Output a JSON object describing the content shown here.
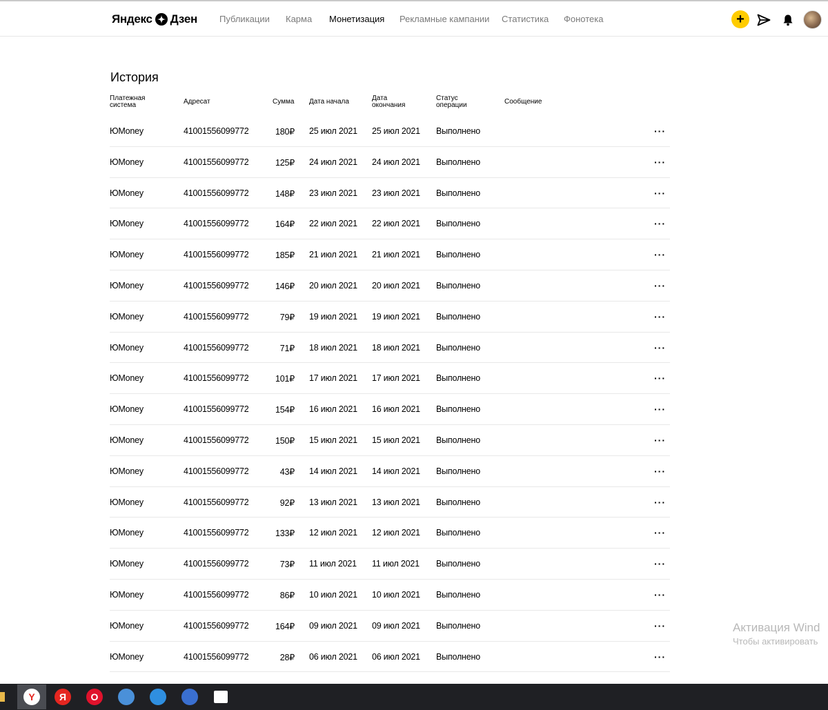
{
  "header": {
    "logo_left": "Яндекс",
    "logo_right": "Дзен",
    "nav": [
      {
        "label": "Публикации",
        "active": false
      },
      {
        "label": "Карма",
        "active": false
      },
      {
        "label": "Монетизация",
        "active": true
      },
      {
        "label": "Рекламные кампании",
        "active": false
      },
      {
        "label": "Статистика",
        "active": false
      },
      {
        "label": "Фонотека",
        "active": false
      }
    ],
    "plus_label": "+",
    "accent": "#ffcc00"
  },
  "page": {
    "title": "История"
  },
  "table": {
    "headers": {
      "system_1": "Платежная",
      "system_2": "система",
      "addressee": "Адресат",
      "sum": "Сумма",
      "start_1": "Дата начала",
      "end_1": "Дата",
      "end_2": "окончания",
      "status_1": "Статус",
      "status_2": "операции",
      "message": "Сообщение"
    },
    "more_label": "···",
    "rows": [
      {
        "system": "ЮMoney",
        "addressee": "41001556099772",
        "sum": "180₽",
        "start": "25 июл 2021",
        "end": "25 июл 2021",
        "status": "Выполнено"
      },
      {
        "system": "ЮMoney",
        "addressee": "41001556099772",
        "sum": "125₽",
        "start": "24 июл 2021",
        "end": "24 июл 2021",
        "status": "Выполнено"
      },
      {
        "system": "ЮMoney",
        "addressee": "41001556099772",
        "sum": "148₽",
        "start": "23 июл 2021",
        "end": "23 июл 2021",
        "status": "Выполнено"
      },
      {
        "system": "ЮMoney",
        "addressee": "41001556099772",
        "sum": "164₽",
        "start": "22 июл 2021",
        "end": "22 июл 2021",
        "status": "Выполнено"
      },
      {
        "system": "ЮMoney",
        "addressee": "41001556099772",
        "sum": "185₽",
        "start": "21 июл 2021",
        "end": "21 июл 2021",
        "status": "Выполнено"
      },
      {
        "system": "ЮMoney",
        "addressee": "41001556099772",
        "sum": "146₽",
        "start": "20 июл 2021",
        "end": "20 июл 2021",
        "status": "Выполнено"
      },
      {
        "system": "ЮMoney",
        "addressee": "41001556099772",
        "sum": "79₽",
        "start": "19 июл 2021",
        "end": "19 июл 2021",
        "status": "Выполнено"
      },
      {
        "system": "ЮMoney",
        "addressee": "41001556099772",
        "sum": "71₽",
        "start": "18 июл 2021",
        "end": "18 июл 2021",
        "status": "Выполнено"
      },
      {
        "system": "ЮMoney",
        "addressee": "41001556099772",
        "sum": "101₽",
        "start": "17 июл 2021",
        "end": "17 июл 2021",
        "status": "Выполнено"
      },
      {
        "system": "ЮMoney",
        "addressee": "41001556099772",
        "sum": "154₽",
        "start": "16 июл 2021",
        "end": "16 июл 2021",
        "status": "Выполнено"
      },
      {
        "system": "ЮMoney",
        "addressee": "41001556099772",
        "sum": "150₽",
        "start": "15 июл 2021",
        "end": "15 июл 2021",
        "status": "Выполнено"
      },
      {
        "system": "ЮMoney",
        "addressee": "41001556099772",
        "sum": "43₽",
        "start": "14 июл 2021",
        "end": "14 июл 2021",
        "status": "Выполнено"
      },
      {
        "system": "ЮMoney",
        "addressee": "41001556099772",
        "sum": "92₽",
        "start": "13 июл 2021",
        "end": "13 июл 2021",
        "status": "Выполнено"
      },
      {
        "system": "ЮMoney",
        "addressee": "41001556099772",
        "sum": "133₽",
        "start": "12 июл 2021",
        "end": "12 июл 2021",
        "status": "Выполнено"
      },
      {
        "system": "ЮMoney",
        "addressee": "41001556099772",
        "sum": "73₽",
        "start": "11 июл 2021",
        "end": "11 июл 2021",
        "status": "Выполнено"
      },
      {
        "system": "ЮMoney",
        "addressee": "41001556099772",
        "sum": "86₽",
        "start": "10 июл 2021",
        "end": "10 июл 2021",
        "status": "Выполнено"
      },
      {
        "system": "ЮMoney",
        "addressee": "41001556099772",
        "sum": "164₽",
        "start": "09 июл 2021",
        "end": "09 июл 2021",
        "status": "Выполнено"
      },
      {
        "system": "ЮMoney",
        "addressee": "41001556099772",
        "sum": "28₽",
        "start": "06 июл 2021",
        "end": "06 июл 2021",
        "status": "Выполнено"
      }
    ]
  },
  "watermark": {
    "line1": "Активация Wind",
    "line2": "Чтобы активировать"
  },
  "taskbar": {
    "items": [
      {
        "name": "yandex-browser-icon",
        "glyph": "Y",
        "color": "#ffffff",
        "text_color": "#e52620",
        "active": true
      },
      {
        "name": "yandex-icon",
        "glyph": "Я",
        "color": "#e52620",
        "text_color": "#ffffff",
        "active": false
      },
      {
        "name": "opera-icon",
        "glyph": "O",
        "color": "#e0122c",
        "text_color": "#ffffff",
        "active": false
      },
      {
        "name": "chrome-icon",
        "glyph": "",
        "color": "#4a90d9",
        "text_color": "#ffffff",
        "active": false
      },
      {
        "name": "cloud-app-icon",
        "glyph": "",
        "color": "#2f8fe0",
        "text_color": "#ffffff",
        "active": false
      },
      {
        "name": "wave-app-icon",
        "glyph": "",
        "color": "#3a6fd0",
        "text_color": "#ffffff",
        "active": false
      },
      {
        "name": "photos-icon",
        "glyph": "",
        "color": "#ffffff",
        "text_color": "#1f2024",
        "active": false
      }
    ]
  }
}
